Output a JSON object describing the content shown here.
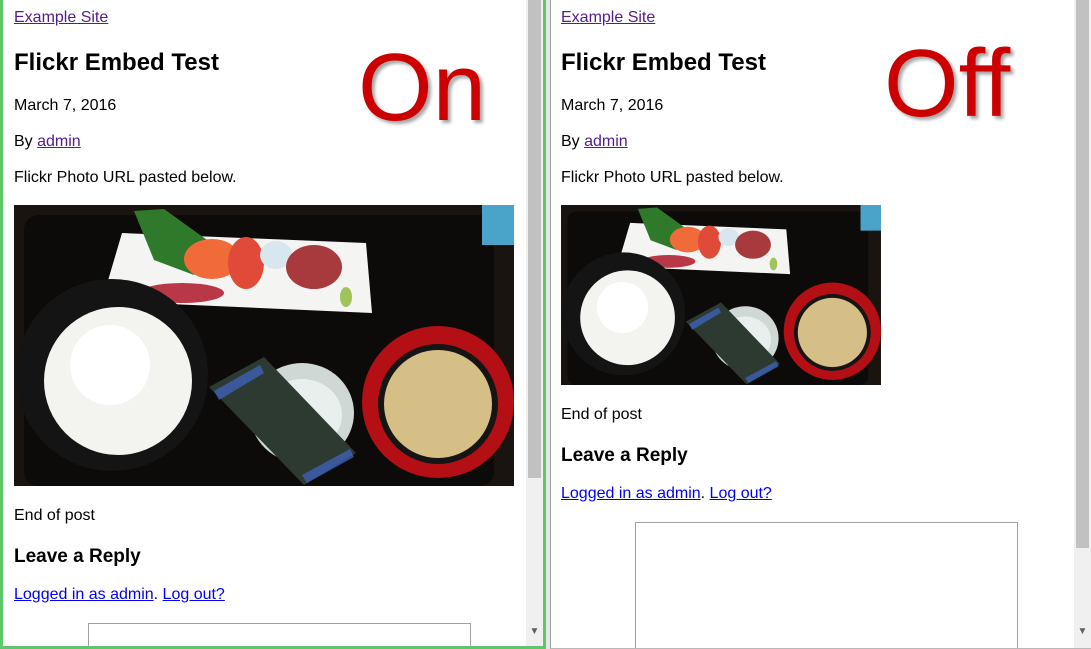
{
  "panes": [
    {
      "site_link": "Example Site",
      "post_title": "Flickr Embed Test",
      "big_label": "On",
      "post_date": "March 7, 2016",
      "byline_prefix": "By ",
      "author": "admin",
      "intro": "Flickr Photo URL pasted below.",
      "photo_alt": "Japanese set meal: sashimi, rice, miso soup, nori",
      "end_text": "End of post",
      "reply_heading": "Leave a Reply",
      "logged_in_link": "Logged in as admin",
      "separator": ". ",
      "logout_link": "Log out?"
    },
    {
      "site_link": "Example Site",
      "post_title": "Flickr Embed Test",
      "big_label": "Off",
      "post_date": "March 7, 2016",
      "byline_prefix": "By ",
      "author": "admin",
      "intro": "Flickr Photo URL pasted below.",
      "photo_alt": "Japanese set meal: sashimi, rice, miso soup, nori",
      "end_text": "End of post",
      "reply_heading": "Leave a Reply",
      "logged_in_link": "Logged in as admin",
      "separator": ". ",
      "logout_link": "Log out?"
    }
  ],
  "colors": {
    "active_pane_border": "#5fc76b",
    "label_red": "#cc0000",
    "visited_link": "#551a8b",
    "link": "#0000ee"
  },
  "icons": {
    "scroll_down": "chevron-down-icon"
  }
}
